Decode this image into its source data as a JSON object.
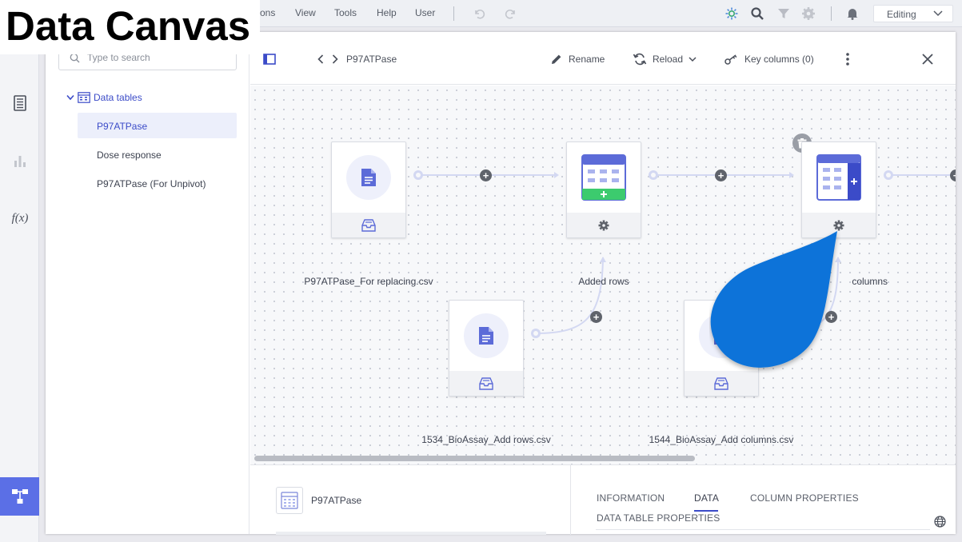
{
  "caption": "Data Canvas",
  "menubar": {
    "items": [
      "ons",
      "View",
      "Tools",
      "Help",
      "User"
    ],
    "mode": "Editing"
  },
  "sidebar": {
    "search_placeholder": "Type to search",
    "section_label": "Data tables",
    "tables": [
      "P97ATPase",
      "Dose response",
      "P97ATPase (For Unpivot)"
    ]
  },
  "toolbar": {
    "breadcrumb": "P97ATPase",
    "rename_label": "Rename",
    "reload_label": "Reload",
    "key_columns_label": "Key columns (0)"
  },
  "canvas": {
    "nodes": {
      "source_replace": "P97ATPase_For replacing.csv",
      "added_rows": "Added rows",
      "added_columns": "columns",
      "source_add_rows": "1534_BioAssay_Add rows.csv",
      "source_add_columns": "1544_BioAssay_Add columns.csv"
    }
  },
  "details": {
    "title": "P97ATPase",
    "tabs": [
      "INFORMATION",
      "DATA",
      "COLUMN PROPERTIES",
      "DATA TABLE PROPERTIES"
    ],
    "active_tab": "DATA"
  },
  "colors": {
    "accent": "#5b6fe6",
    "link": "#3b4bc8",
    "node_icon": "#5c6bd8",
    "add_rows_green": "#3ccb6e",
    "callout": "#0a73d9"
  }
}
